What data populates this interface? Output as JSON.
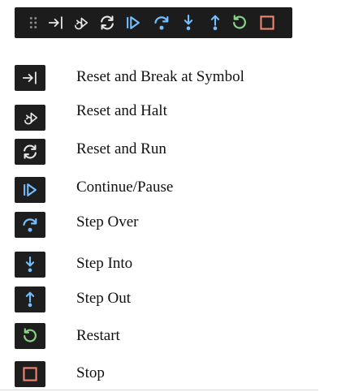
{
  "colors": {
    "toolbar_bg": "#1c1c1c",
    "icon_bg": "#1e1e1e",
    "blue": "#75beff",
    "white": "#e8e8e8",
    "green": "#89d185",
    "orange": "#f48771",
    "label_text": "#111111"
  },
  "toolbar": {
    "icons": [
      "gripper-icon",
      "break-at-symbol-icon",
      "reset-halt-icon",
      "reset-run-icon",
      "continue-pause-icon",
      "step-over-icon",
      "step-into-icon",
      "step-out-icon",
      "restart-icon",
      "stop-icon"
    ]
  },
  "legend": {
    "items": [
      {
        "icon": "break-at-symbol-icon",
        "label": "Reset and Break at Symbol"
      },
      {
        "icon": "reset-halt-icon",
        "label": "Reset and Halt"
      },
      {
        "icon": "reset-run-icon",
        "label": "Reset and Run"
      },
      {
        "icon": "continue-pause-icon",
        "label": "Continue/Pause"
      },
      {
        "icon": "step-over-icon",
        "label": "Step Over"
      },
      {
        "icon": "step-into-icon",
        "label": "Step Into"
      },
      {
        "icon": "step-out-icon",
        "label": "Step Out"
      },
      {
        "icon": "restart-icon",
        "label": "Restart"
      },
      {
        "icon": "stop-icon",
        "label": "Stop"
      }
    ]
  }
}
